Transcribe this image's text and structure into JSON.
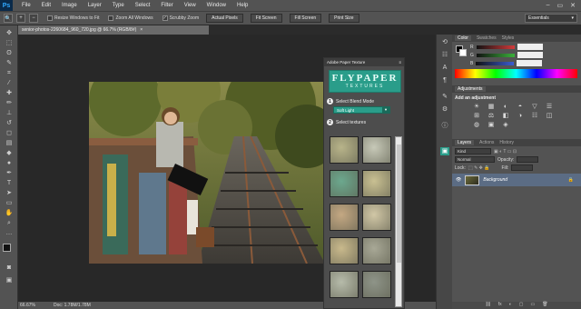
{
  "app": {
    "logo": "Ps"
  },
  "menu": [
    "File",
    "Edit",
    "Image",
    "Layer",
    "Type",
    "Select",
    "Filter",
    "View",
    "Window",
    "Help"
  ],
  "window_controls": [
    "–",
    "▭",
    "✕"
  ],
  "options": {
    "resize_windows_to_fit": "Resize Windows to Fit",
    "zoom_all_windows": "Zoom All Windows",
    "scrubby_zoom": "Scrubby Zoom",
    "buttons": [
      "Actual Pixels",
      "Fit Screen",
      "Fill Screen",
      "Print Size"
    ],
    "workspace": "Essentials"
  },
  "document": {
    "tab_title": "senior-photos-2260684_960_720.jpg @ 66.7% (RGB/8#)",
    "zoom": "66.67%",
    "doc_size": "Doc: 1.78M/1.78M"
  },
  "paper_texture_panel": {
    "title": "Adobe Paper Texture",
    "logo_line1": "FLYPAPER",
    "logo_line2": "TEXTURES",
    "step1_num": "1",
    "step1_label": "Select Blend Mode",
    "blend_mode": "Soft Light",
    "step2_num": "2",
    "step2_label": "Select textures",
    "swatch_colors": [
      "#b8b48a",
      "#c7c9b8",
      "#6ca88e",
      "#c9c092",
      "#c4a883",
      "#d1c7a6",
      "#c9b98c",
      "#a8a896",
      "#b6bbaa",
      "#8e9488"
    ]
  },
  "color_panel": {
    "tabs": [
      "Color",
      "Swatches",
      "Styles"
    ],
    "sliders": [
      {
        "label": "R",
        "value": "",
        "color": "#d23b3b"
      },
      {
        "label": "G",
        "value": "",
        "color": "#3bb03b"
      },
      {
        "label": "B",
        "value": "",
        "color": "#3b5bd2"
      }
    ]
  },
  "adjustments_panel": {
    "title": "Adjustments",
    "subtitle": "Add an adjustment",
    "icons": [
      "☀",
      "▦",
      "◐",
      "◓",
      "▽",
      "☰",
      "⊞",
      "⚖",
      "◧",
      "◑",
      "☷",
      "◫",
      "◍",
      "▣",
      "◈"
    ]
  },
  "layers_panel": {
    "tabs": [
      "Layers",
      "Actions",
      "History"
    ],
    "kind": "Kind",
    "blend": "Normal",
    "opacity_label": "Opacity:",
    "lock_label": "Lock:",
    "fill_label": "Fill:",
    "layer_name": "Background",
    "footer_icons": [
      "⛓",
      "fx",
      "◐",
      "▢",
      "▭",
      "🗑"
    ]
  }
}
